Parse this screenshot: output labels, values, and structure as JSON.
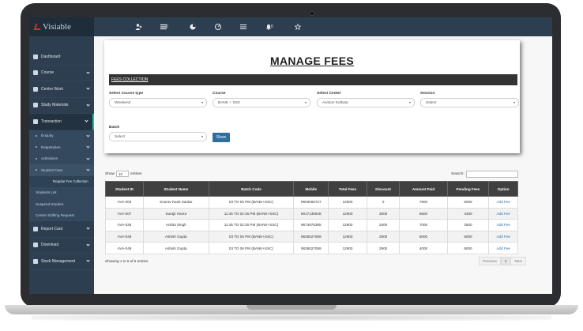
{
  "brand": {
    "name": "Visiable"
  },
  "topbar": {
    "icons": [
      "add-user-icon",
      "list-icon",
      "pie-chart-icon",
      "dashboard-icon",
      "menu-icon",
      "bell-icon",
      "star-icon"
    ],
    "badges": {
      "list": "0",
      "bell": "0"
    }
  },
  "sidebar": {
    "items": [
      {
        "label": "Dashboard",
        "icon": "home-icon"
      },
      {
        "label": "Course",
        "icon": "book-icon"
      },
      {
        "label": "Centre Work",
        "icon": "building-icon"
      },
      {
        "label": "Study Materials",
        "icon": "chart-icon"
      },
      {
        "label": "Transaction",
        "icon": "monitor-icon"
      }
    ],
    "sub_items": [
      {
        "label": "Enquiry"
      },
      {
        "label": "Registration"
      },
      {
        "label": "Admission"
      },
      {
        "label": "Student Fees"
      }
    ],
    "subsub_item": "Regular Fee Collection",
    "plain_items": [
      "Students List",
      "Suspend Student",
      "Centre Shifting Request"
    ],
    "bottom_items": [
      {
        "label": "Report Card",
        "icon": "file-icon"
      },
      {
        "label": "Download",
        "icon": "download-icon"
      },
      {
        "label": "Stock Management",
        "icon": "cart-icon"
      }
    ]
  },
  "page": {
    "title": "MANAGE FEES",
    "section": "FEES COLLECTION",
    "fields": {
      "course_type": {
        "label": "Select Course type",
        "value": "Weekend"
      },
      "course": {
        "label": "Course",
        "value": "BANK + SSC"
      },
      "center": {
        "label": "Select Center",
        "value": "Avision Kolkata"
      },
      "session": {
        "label": "Session",
        "value": "Select"
      },
      "batch": {
        "label": "Batch",
        "value": "Select"
      }
    },
    "show_button": "Show"
  },
  "table": {
    "show_label": "Show",
    "entries_value": "10",
    "entries_label": "entries",
    "search_label": "Search:",
    "columns": [
      "Student ID",
      "Student Name",
      "Batch Code",
      "Mobile",
      "Total Fees",
      "Discount",
      "Amount Paid",
      "Pending Fees",
      "Option"
    ],
    "rows": [
      [
        "AVA-003",
        "Sourav Kanti Sardar",
        "03 TO 06 PM (BANK+SSC)",
        "9903066727",
        "12900",
        "0",
        "7900",
        "5000",
        "Add Fee"
      ],
      [
        "AVA-007",
        "Surajit Hazra",
        "11:45 TO 02:45 PM (BANK+SSC)",
        "8017135648",
        "12900",
        "3000",
        "5500",
        "4400",
        "Add Fee"
      ],
      [
        "AVA-026",
        "Ankita Singh",
        "11:45 TO 02:45 PM (BANK+SSC)",
        "9674975385",
        "12900",
        "3400",
        "7000",
        "2500",
        "Add Fee"
      ],
      [
        "AVA-046",
        "Ashish Gupta",
        "03 TO 06 PM (BANK+SSC)",
        "9836527059",
        "12900",
        "2900",
        "5000",
        "5000",
        "Add Fee"
      ],
      [
        "AVA-049",
        "Ashish Gupta",
        "03 TO 06 PM (BANK+SSC)",
        "9836527059",
        "12900",
        "2900",
        "4000",
        "6000",
        "Add Fee"
      ]
    ],
    "footer": "Showing 1 to 5 of 5 entries",
    "pager": {
      "previous": "Previous",
      "current": "1",
      "next": "Next"
    }
  }
}
